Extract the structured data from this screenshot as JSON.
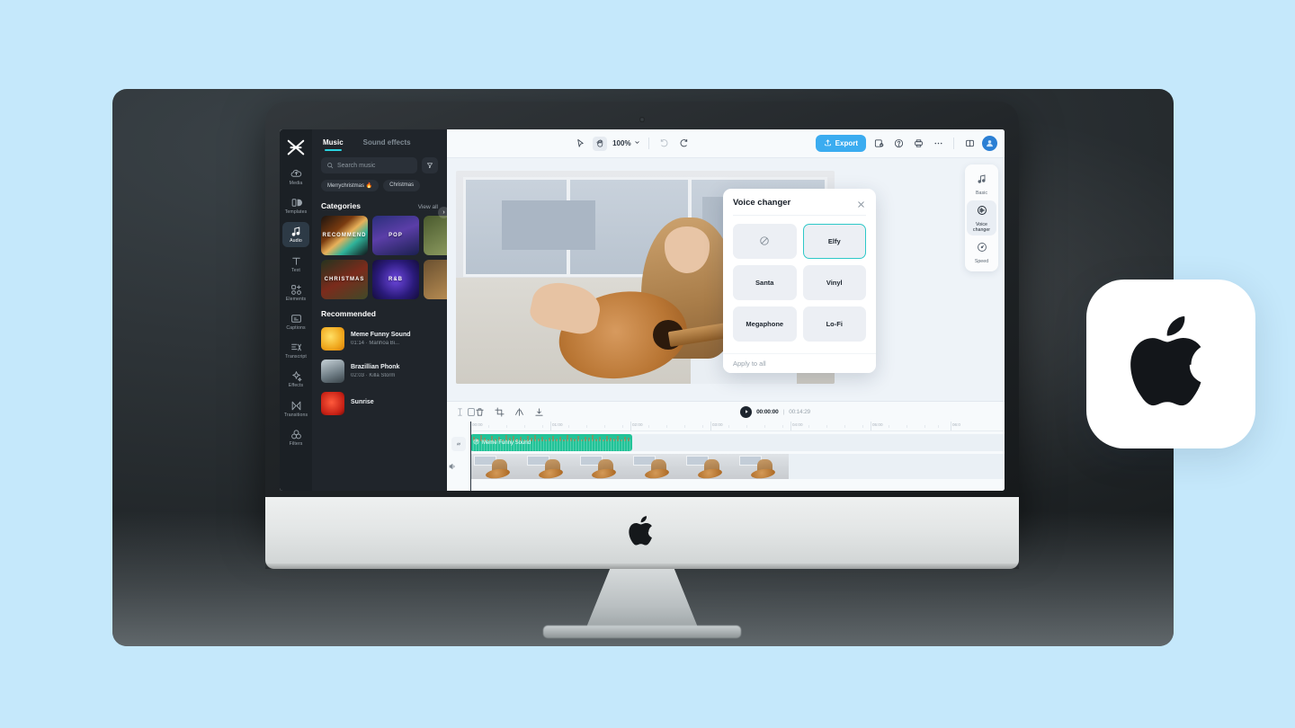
{
  "theme": {
    "page_bg": "#c5e8fb",
    "accent_blue": "#3bacf0",
    "accent_teal": "#2ad3e0",
    "clip_green": "#22c398",
    "selected_border": "#2ec8c8"
  },
  "rail": {
    "logo_name": "capcut-logo",
    "items": [
      {
        "label": "Media",
        "icon": "cloud-upload-icon",
        "active": false
      },
      {
        "label": "Templates",
        "icon": "template-icon",
        "active": false
      },
      {
        "label": "Audio",
        "icon": "music-note-icon",
        "active": true
      },
      {
        "label": "Text",
        "icon": "text-t-icon",
        "active": false
      },
      {
        "label": "Elements",
        "icon": "elements-icon",
        "active": false
      },
      {
        "label": "Captions",
        "icon": "captions-icon",
        "active": false
      },
      {
        "label": "Transcript",
        "icon": "transcript-icon",
        "active": false
      },
      {
        "label": "Effects",
        "icon": "effects-sparkle-icon",
        "active": false
      },
      {
        "label": "Transitions",
        "icon": "transitions-icon",
        "active": false
      },
      {
        "label": "Filters",
        "icon": "filters-icon",
        "active": false
      }
    ]
  },
  "panel": {
    "tabs": [
      {
        "label": "Music",
        "active": true
      },
      {
        "label": "Sound effects",
        "active": false
      }
    ],
    "search": {
      "placeholder": "Search music",
      "value": "",
      "icon": "search-icon"
    },
    "filter_icon": "filter-funnel-icon",
    "tags": [
      "Merrychristmas 🔥",
      "Christmas"
    ],
    "categories_title": "Categories",
    "view_all": "View all",
    "categories": [
      {
        "label": "RECOMMEND"
      },
      {
        "label": "POP"
      },
      {
        "label": ""
      },
      {
        "label": "CHRISTMAS"
      },
      {
        "label": "R&B"
      },
      {
        "label": ""
      }
    ],
    "recommended_title": "Recommended",
    "tracks": [
      {
        "title": "Meme Funny Sound",
        "meta": "01:14 · Manhoa Bi..."
      },
      {
        "title": "Brazillian Phonk",
        "meta": "02:03 · Killa Storm"
      },
      {
        "title": "Sunrise",
        "meta": ""
      }
    ]
  },
  "topbar": {
    "select_icon": "cursor-arrow-icon",
    "hand_icon": "hand-grab-icon",
    "zoom": "100%",
    "chevron_icon": "chevron-down-icon",
    "undo_icon": "undo-icon",
    "redo_icon": "redo-icon",
    "export_label": "Export",
    "export_icon": "export-upload-icon",
    "backup_icon": "cloud-backup-icon",
    "help_icon": "help-circle-icon",
    "print_icon": "print-icon",
    "more_icon": "more-dots-icon",
    "layout_icon": "split-layout-icon",
    "avatar_icon": "user-avatar-icon"
  },
  "dock": {
    "items": [
      {
        "label": "Basic",
        "icon": "music-note-icon",
        "active": false
      },
      {
        "label": "Voice changer",
        "icon": "voice-changer-icon",
        "active": true
      },
      {
        "label": "Speed",
        "icon": "speedometer-icon",
        "active": false
      }
    ]
  },
  "voice_changer": {
    "title": "Voice changer",
    "close_icon": "close-x-icon",
    "options": [
      {
        "label": "",
        "icon": "none-slash-icon",
        "selected": false
      },
      {
        "label": "Elfy",
        "icon": "",
        "selected": true
      },
      {
        "label": "Santa",
        "icon": "",
        "selected": false
      },
      {
        "label": "Vinyl",
        "icon": "",
        "selected": false
      },
      {
        "label": "Megaphone",
        "icon": "",
        "selected": false
      },
      {
        "label": "Lo-Fi",
        "icon": "",
        "selected": false
      }
    ],
    "apply_all": "Apply to all"
  },
  "timeline": {
    "tools": [
      {
        "icon": "split-cursor-icon",
        "name": "split-tool"
      },
      {
        "icon": "delete-trash-icon",
        "name": "delete-tool"
      },
      {
        "icon": "crop-icon",
        "name": "crop-tool"
      },
      {
        "icon": "mirror-icon",
        "name": "mirror-tool"
      },
      {
        "icon": "download-icon",
        "name": "download-tool"
      }
    ],
    "play_icon": "play-icon",
    "current_time": "00:00:00",
    "separator": "|",
    "total_time": "00:14:29",
    "ruler_labels": [
      "00:00",
      "01:00",
      "02:00",
      "03:00",
      "04:00",
      "05:00",
      "06:0"
    ],
    "audio_clip": {
      "label": "Meme Funny Sound",
      "icon": "music-note-small-icon"
    },
    "gutter_icon": "link-audio-icon",
    "volume_icon": "volume-icon"
  },
  "apple_card": {
    "icon": "apple-logo-icon"
  },
  "imac": {
    "logo_icon": "apple-logo-icon"
  }
}
